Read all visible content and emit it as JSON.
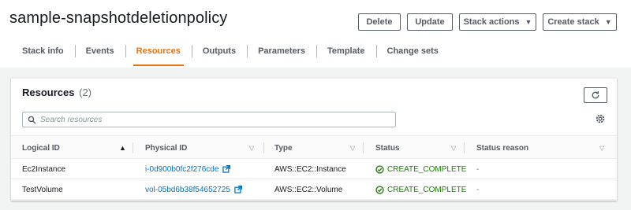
{
  "page": {
    "title": "sample-snapshotdeletionpolicy"
  },
  "actions": {
    "delete": "Delete",
    "update": "Update",
    "stack_actions": "Stack actions",
    "create_stack": "Create stack"
  },
  "tabs": [
    {
      "label": "Stack info"
    },
    {
      "label": "Events"
    },
    {
      "label": "Resources"
    },
    {
      "label": "Outputs"
    },
    {
      "label": "Parameters"
    },
    {
      "label": "Template"
    },
    {
      "label": "Change sets"
    }
  ],
  "active_tab": "Resources",
  "resources": {
    "title": "Resources",
    "count": "(2)",
    "search_placeholder": "Search resources",
    "columns": [
      "Logical ID",
      "Physical ID",
      "Type",
      "Status",
      "Status reason"
    ],
    "rows": [
      {
        "logical_id": "Ec2Instance",
        "physical_id": "i-0d900b0fc2f276cde",
        "type": "AWS::EC2::Instance",
        "status": "CREATE_COMPLETE",
        "status_reason": "-"
      },
      {
        "logical_id": "TestVolume",
        "physical_id": "vol-05bd6b38f54652725",
        "type": "AWS::EC2::Volume",
        "status": "CREATE_COMPLETE",
        "status_reason": "-"
      }
    ]
  },
  "colors": {
    "accent": "#ec7211",
    "link": "#0073bb",
    "success": "#1d8102"
  },
  "icons": [
    "caret-down-icon",
    "refresh-icon",
    "search-icon",
    "settings-gear-icon",
    "sort-asc-icon",
    "sort-desc-icon",
    "external-link-icon",
    "status-success-icon"
  ]
}
